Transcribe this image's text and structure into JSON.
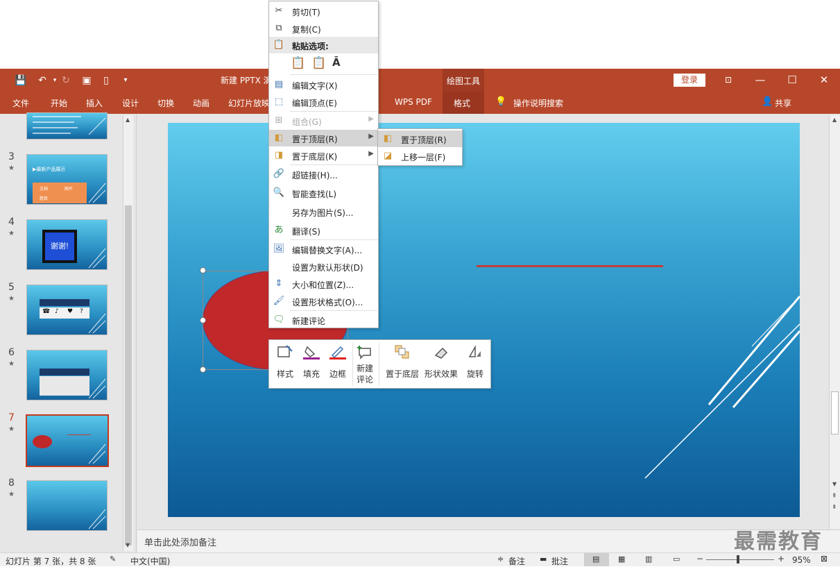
{
  "window": {
    "title": "新建 PPTX 演",
    "contextual_tab_group": "绘图工具",
    "login_button": "登录",
    "share_label": "共享"
  },
  "ribbon": {
    "tabs": [
      "文件",
      "开始",
      "插入",
      "设计",
      "切换",
      "动画",
      "幻灯片放映",
      "WPS PDF",
      "格式"
    ],
    "active_tab": "格式",
    "tell_me": "操作说明搜索"
  },
  "thumbnails": {
    "numbers": [
      "3",
      "4",
      "5",
      "6",
      "7",
      "8"
    ],
    "selected": "7",
    "slide3_title": "▶最新产品展示",
    "slide3_cells": [
      "文档",
      "题目",
      "图片"
    ],
    "slide4_text": "谢谢!",
    "slide5_symbols": [
      "☎",
      "♪",
      "♥",
      "?"
    ]
  },
  "context_menu": {
    "items": [
      {
        "icon": "scissors-icon",
        "label": "剪切(T)"
      },
      {
        "icon": "copy-icon",
        "label": "复制(C)"
      },
      {
        "icon": "clipboard-icon",
        "label": "粘贴选项:"
      },
      {
        "icon": "edit-text-icon",
        "label": "编辑文字(X)"
      },
      {
        "icon": "edit-points-icon",
        "label": "编辑顶点(E)"
      },
      {
        "icon": "group-icon",
        "label": "组合(G)"
      },
      {
        "icon": "bring-front-icon",
        "label": "置于顶层(R)"
      },
      {
        "icon": "send-back-icon",
        "label": "置于底层(K)"
      },
      {
        "icon": "hyperlink-icon",
        "label": "超链接(H)..."
      },
      {
        "icon": "smart-lookup-icon",
        "label": "智能查找(L)"
      },
      {
        "icon": "",
        "label": "另存为图片(S)..."
      },
      {
        "icon": "translate-icon",
        "label": "翻译(S)"
      },
      {
        "icon": "alt-text-icon",
        "label": "编辑替换文字(A)..."
      },
      {
        "icon": "",
        "label": "设置为默认形状(D)"
      },
      {
        "icon": "size-position-icon",
        "label": "大小和位置(Z)..."
      },
      {
        "icon": "format-shape-icon",
        "label": "设置形状格式(O)..."
      },
      {
        "icon": "new-comment-icon",
        "label": "新建评论"
      }
    ],
    "submenu": [
      "置于顶层(R)",
      "上移一层(F)"
    ]
  },
  "mini_toolbar": {
    "buttons": [
      "样式",
      "填充",
      "边框",
      "新建评论",
      "置于底层",
      "形状效果",
      "旋转"
    ],
    "new_comment_line1": "新建",
    "new_comment_line2": "评论",
    "fill_color": "#9b1f8f",
    "outline_color": "#e02020"
  },
  "notes": {
    "placeholder": "单击此处添加备注"
  },
  "status": {
    "slide_info": "幻灯片 第 7 张，共 8 张",
    "language": "中文(中国)",
    "notes_label": "备注",
    "comments_label": "批注",
    "zoom": "95%"
  },
  "watermark": "最需教育",
  "colors": {
    "ribbon": "#b7472a",
    "shape_fill": "#c0282a",
    "line": "#c0403a"
  }
}
